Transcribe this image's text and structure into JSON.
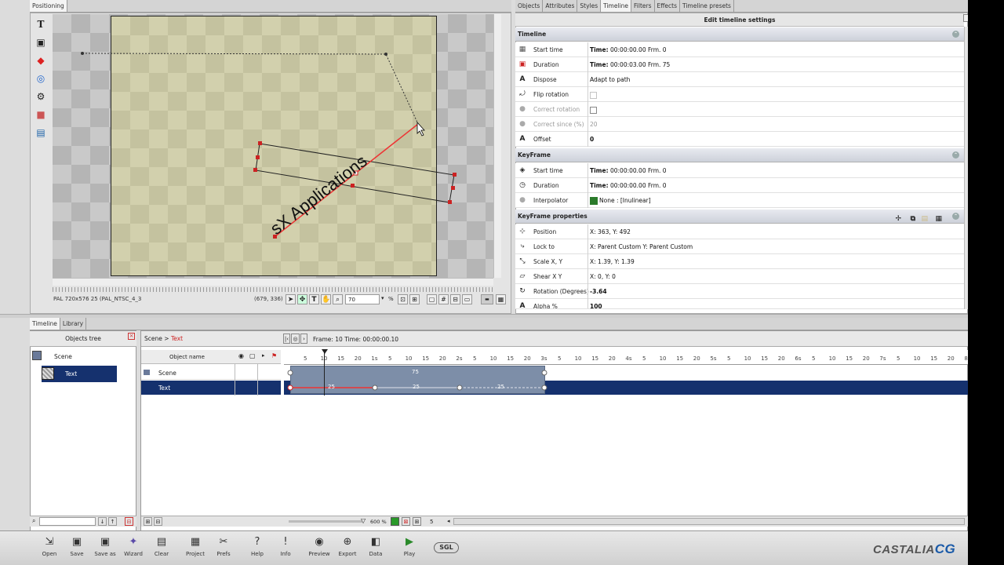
{
  "left_panel": {
    "tab_label": "Positioning"
  },
  "tools": [
    "text-tool-icon",
    "image-tool-icon",
    "shapes-tool-icon",
    "clock-tool-icon",
    "video-tool-icon",
    "cube-tool-icon",
    "picture-tool-icon"
  ],
  "canvas": {
    "text": "sX Applications",
    "status_left": "PAL 720x576 25 (PAL_NTSC_4_3",
    "status_coords": "(679, 336)",
    "zoom_value": "70",
    "zoom_unit": "%"
  },
  "right_panel": {
    "tabs": [
      "Objects",
      "Attributes",
      "Styles",
      "Timeline",
      "Filters",
      "Effects",
      "Timeline presets"
    ],
    "active_tab": "Timeline",
    "title": "Edit timeline settings",
    "sections": {
      "timeline": "Timeline",
      "keyframe": "KeyFrame",
      "keyframe_props": "KeyFrame properties"
    },
    "timeline_rows": [
      {
        "label": "Start time",
        "value_bold": "Time:",
        "value": " 00:00:00.00 Frm. 0"
      },
      {
        "label": "Duration",
        "value_bold": "Time:",
        "value": " 00:00:03.00 Frm. 75"
      },
      {
        "label": "Dispose",
        "value": "Adapt to path"
      },
      {
        "label": "Flip rotation",
        "value": ""
      },
      {
        "label": "Correct rotation",
        "value": ""
      },
      {
        "label": "Correct since (%)",
        "value": "20"
      },
      {
        "label": "Offset",
        "value_bold": "0",
        "value": ""
      }
    ],
    "keyframe_rows": [
      {
        "label": "Start time",
        "value_bold": "Time:",
        "value": " 00:00:00.00 Frm. 0"
      },
      {
        "label": "Duration",
        "value_bold": "Time:",
        "value": " 00:00:00.00 Frm. 0"
      },
      {
        "label": "Interpolator",
        "value": "None : [Inulinear]"
      }
    ],
    "keyframe_prop_rows": [
      {
        "label": "Position",
        "value": "X: 363, Y: 492"
      },
      {
        "label": "Lock to",
        "value": "X: Parent Custom Y: Parent Custom"
      },
      {
        "label": "Scale X, Y",
        "value": "X: 1.39, Y: 1.39"
      },
      {
        "label": "Shear X Y",
        "value": "X: 0, Y: 0"
      },
      {
        "label": "Rotation (Degrees)",
        "value_bold": "-3.64",
        "value": ""
      },
      {
        "label": "Alpha %",
        "value_bold": "100",
        "value": ""
      }
    ]
  },
  "bottom_tabs": [
    "Timeline",
    "Library"
  ],
  "objects_tree": {
    "header": "Objects tree",
    "items": [
      "Scene",
      "Text"
    ]
  },
  "timeline_panel": {
    "breadcrumb_root": "Scene",
    "breadcrumb_sep": ">",
    "breadcrumb_current": "Text",
    "frame_info": "Frame: 10 Time: 00:00:00.10",
    "object_name_header": "Object name",
    "rows": [
      "Scene",
      "Text"
    ],
    "scene_bar_label": "75",
    "text_segments": [
      "25",
      "25",
      "25"
    ],
    "zoom_label": "600 %",
    "step_value": "5",
    "ticks": [
      "5",
      "10",
      "15",
      "20",
      "1s",
      "5",
      "10",
      "15",
      "20",
      "2s",
      "5",
      "10",
      "15",
      "20",
      "3s",
      "5",
      "10",
      "15",
      "20",
      "4s",
      "5",
      "10",
      "15",
      "20",
      "5s",
      "5",
      "10",
      "15",
      "20",
      "6s",
      "5",
      "10",
      "15",
      "20",
      "7s",
      "5",
      "10",
      "15",
      "20",
      "8"
    ]
  },
  "toolbar": {
    "buttons": [
      {
        "label": "Open",
        "icon": "open-icon"
      },
      {
        "label": "Save",
        "icon": "save-icon"
      },
      {
        "label": "Save as",
        "icon": "save-as-icon"
      },
      {
        "label": "Wizard",
        "icon": "wizard-icon"
      },
      {
        "label": "Clear",
        "icon": "clear-icon"
      },
      {
        "label": "Project",
        "icon": "project-icon"
      },
      {
        "label": "Prefs",
        "icon": "prefs-icon"
      },
      {
        "label": "Help",
        "icon": "help-icon"
      },
      {
        "label": "Info",
        "icon": "info-icon"
      },
      {
        "label": "Preview",
        "icon": "preview-icon"
      },
      {
        "label": "Export",
        "icon": "export-icon"
      },
      {
        "label": "Data",
        "icon": "data-icon"
      },
      {
        "label": "Play",
        "icon": "play-icon"
      }
    ],
    "sgl_logo": "SGL",
    "brand": "CASTALIA",
    "brand_suffix": "CG"
  }
}
